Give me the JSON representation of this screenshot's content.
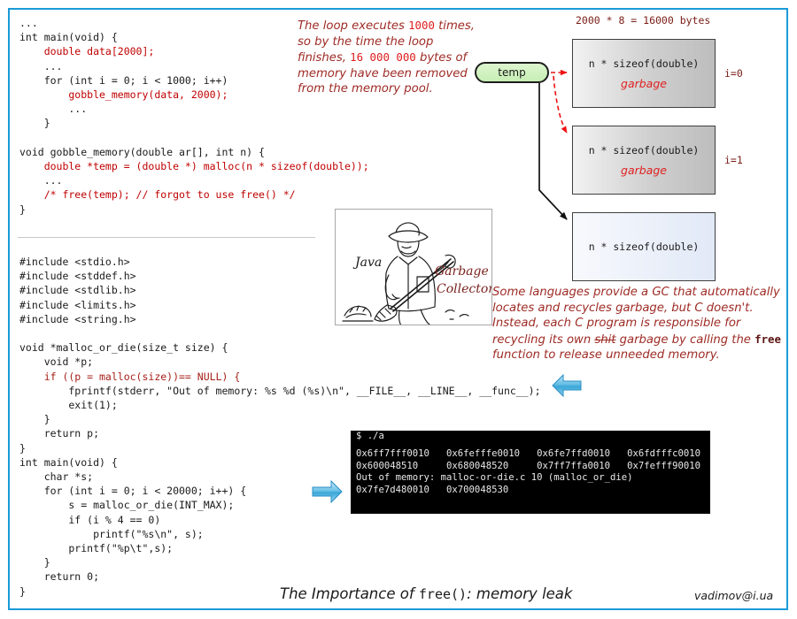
{
  "frame": {
    "border_color": "#1a9ad7"
  },
  "code_top": {
    "name": "gobble-memory-example",
    "lines": [
      [
        {
          "t": "...",
          "c": "black"
        }
      ],
      [
        {
          "t": "int main(void) {",
          "c": "black"
        }
      ],
      [
        {
          "t": "    double data[2000];",
          "c": "red"
        }
      ],
      [
        {
          "t": "    ...",
          "c": "black"
        }
      ],
      [
        {
          "t": "    for (int i = 0; i < 1000; i++)",
          "c": "black"
        }
      ],
      [
        {
          "t": "        gobble_memory(data, 2000);",
          "c": "red"
        }
      ],
      [
        {
          "t": "        ...",
          "c": "black"
        }
      ],
      [
        {
          "t": "    }",
          "c": "black"
        }
      ],
      [
        {
          "t": "",
          "c": "black"
        }
      ],
      [
        {
          "t": "void gobble_memory(double ar[], int n) {",
          "c": "black"
        }
      ],
      [
        {
          "t": "    double *temp = (double *) malloc(n * sizeof(double));",
          "c": "red"
        }
      ],
      [
        {
          "t": "    ...",
          "c": "black"
        }
      ],
      [
        {
          "t": "    /* free(temp); // forgot to use free() */",
          "c": "red"
        }
      ],
      [
        {
          "t": "}",
          "c": "black"
        }
      ]
    ]
  },
  "code_bottom": {
    "name": "malloc-or-die-example",
    "lines": [
      [
        {
          "t": "#include <stdio.h>",
          "c": "black"
        }
      ],
      [
        {
          "t": "#include <stddef.h>",
          "c": "black"
        }
      ],
      [
        {
          "t": "#include <stdlib.h>",
          "c": "black"
        }
      ],
      [
        {
          "t": "#include <limits.h>",
          "c": "black"
        }
      ],
      [
        {
          "t": "#include <string.h>",
          "c": "black"
        }
      ],
      [
        {
          "t": "",
          "c": "black"
        }
      ],
      [
        {
          "t": "void *malloc_or_die(size_t size) {",
          "c": "black"
        }
      ],
      [
        {
          "t": "    void *p;",
          "c": "black"
        }
      ],
      [
        {
          "t": "    if ((p = malloc(size))== NULL) {",
          "c": "dkred"
        }
      ],
      [
        {
          "t": "        fprintf(stderr, \"Out of memory: %s %d (%s)\\n\", __FILE__, __LINE__, __func__);",
          "c": "black"
        }
      ],
      [
        {
          "t": "        exit(1);",
          "c": "black"
        }
      ],
      [
        {
          "t": "    }",
          "c": "black"
        }
      ],
      [
        {
          "t": "    return p;",
          "c": "black"
        }
      ],
      [
        {
          "t": "}",
          "c": "black"
        }
      ],
      [
        {
          "t": "int main(void) {",
          "c": "black"
        }
      ],
      [
        {
          "t": "    char *s;",
          "c": "black"
        }
      ],
      [
        {
          "t": "    for (int i = 0; i < 20000; i++) {",
          "c": "black"
        }
      ],
      [
        {
          "t": "        s = malloc_or_die(INT_MAX);",
          "c": "black"
        }
      ],
      [
        {
          "t": "        if (i % 4 == 0)",
          "c": "black"
        }
      ],
      [
        {
          "t": "            printf(\"%s\\n\", s);",
          "c": "black"
        }
      ],
      [
        {
          "t": "        printf(\"%p\\t\",s);",
          "c": "black"
        }
      ],
      [
        {
          "t": "    }",
          "c": "black"
        }
      ],
      [
        {
          "t": "    return 0;",
          "c": "black"
        }
      ],
      [
        {
          "t": "}",
          "c": "black"
        }
      ]
    ]
  },
  "note_loop": {
    "segments": [
      {
        "t": "The loop executes ",
        "k": "txt"
      },
      {
        "t": "1000",
        "k": "num"
      },
      {
        "t": " times, so by the time the loop finishes, ",
        "k": "txt"
      },
      {
        "t": "16 000 000",
        "k": "num"
      },
      {
        "t": " bytes of memory have been removed from the memory pool.",
        "k": "txt"
      }
    ]
  },
  "note_gc": {
    "segments": [
      {
        "t": "Some languages provide a GC that automatically locates and recycles garbage, but C doesn't. Instead, each C program is responsible for recycling its own ",
        "k": "txt"
      },
      {
        "t": "shit",
        "k": "strike"
      },
      {
        "t": " garbage by calling the ",
        "k": "txt"
      },
      {
        "t": "free",
        "k": "kw"
      },
      {
        "t": " function to release unneeded memory.",
        "k": "txt"
      }
    ]
  },
  "diagram": {
    "header": "2000 * 8 = 16000 bytes",
    "pointer_label": "temp",
    "blocks": [
      {
        "label": "n * sizeof(double)",
        "garbage": "garbage",
        "index": "i=0",
        "style": "grey"
      },
      {
        "label": "n * sizeof(double)",
        "garbage": "garbage",
        "index": "i=1",
        "style": "grey"
      },
      {
        "label": "n * sizeof(double)",
        "garbage": "",
        "index": "",
        "style": "blue"
      }
    ]
  },
  "gc_picture": {
    "caption_java": "Java",
    "caption_garbage": "Garbage",
    "caption_collector": "Collector"
  },
  "terminal": {
    "prompt_line": "$ ./a",
    "lines": [
      "0x6ff7fff0010   0x6fefffe0010   0x6fe7ffd0010   0x6fdfffc0010",
      "0x600048510     0x680048520     0x7ff7ffa0010   0x7fefff90010",
      "Out of memory: malloc-or-die.c 10 (malloc_or_die)",
      "0x7fe7d480010   0x700048530"
    ]
  },
  "footer": {
    "title_pre": "The Importance of ",
    "title_mono": "free()",
    "title_post": ": memory leak",
    "email": "vadimov@i.ua"
  }
}
